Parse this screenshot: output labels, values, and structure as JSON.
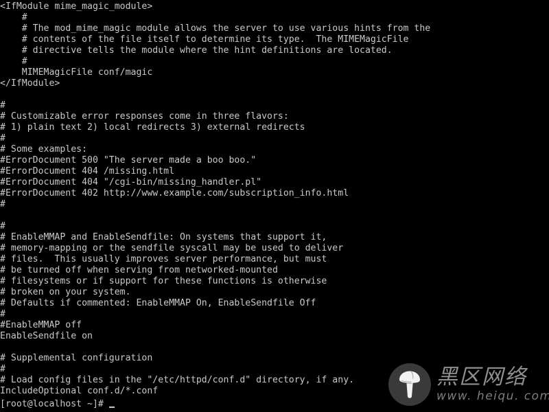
{
  "terminal": {
    "background_color": "#000000",
    "text_color": "#c9c9c9",
    "font_size_px": 13,
    "line_height_px": 16,
    "columns": 100,
    "rows": 37,
    "lines": [
      "<IfModule mime_magic_module>",
      "    #",
      "    # The mod_mime_magic module allows the server to use various hints from the",
      "    # contents of the file itself to determine its type.  The MIMEMagicFile",
      "    # directive tells the module where the hint definitions are located.",
      "    #",
      "    MIMEMagicFile conf/magic",
      "</IfModule>",
      "",
      "#",
      "# Customizable error responses come in three flavors:",
      "# 1) plain text 2) local redirects 3) external redirects",
      "#",
      "# Some examples:",
      "#ErrorDocument 500 \"The server made a boo boo.\"",
      "#ErrorDocument 404 /missing.html",
      "#ErrorDocument 404 \"/cgi-bin/missing_handler.pl\"",
      "#ErrorDocument 402 http://www.example.com/subscription_info.html",
      "#",
      "",
      "#",
      "# EnableMMAP and EnableSendfile: On systems that support it,",
      "# memory-mapping or the sendfile syscall may be used to deliver",
      "# files.  This usually improves server performance, but must",
      "# be turned off when serving from networked-mounted",
      "# filesystems or if support for these functions is otherwise",
      "# broken on your system.",
      "# Defaults if commented: EnableMMAP On, EnableSendfile Off",
      "#",
      "#EnableMMAP off",
      "EnableSendfile on",
      "",
      "# Supplemental configuration",
      "#",
      "# Load config files in the \"/etc/httpd/conf.d\" directory, if any.",
      "IncludeOptional conf.d/*.conf"
    ],
    "prompt": "[root@localhost ~]# ",
    "command_input": "",
    "cursor_glyph": "_"
  },
  "watermark": {
    "logo_icon": "mushroom-icon",
    "logo_bg_color": "#3a3a3a",
    "brand_cn": "黑区网络",
    "brand_url": "www. heiqu. com",
    "text_color": "#8e8e8e"
  }
}
